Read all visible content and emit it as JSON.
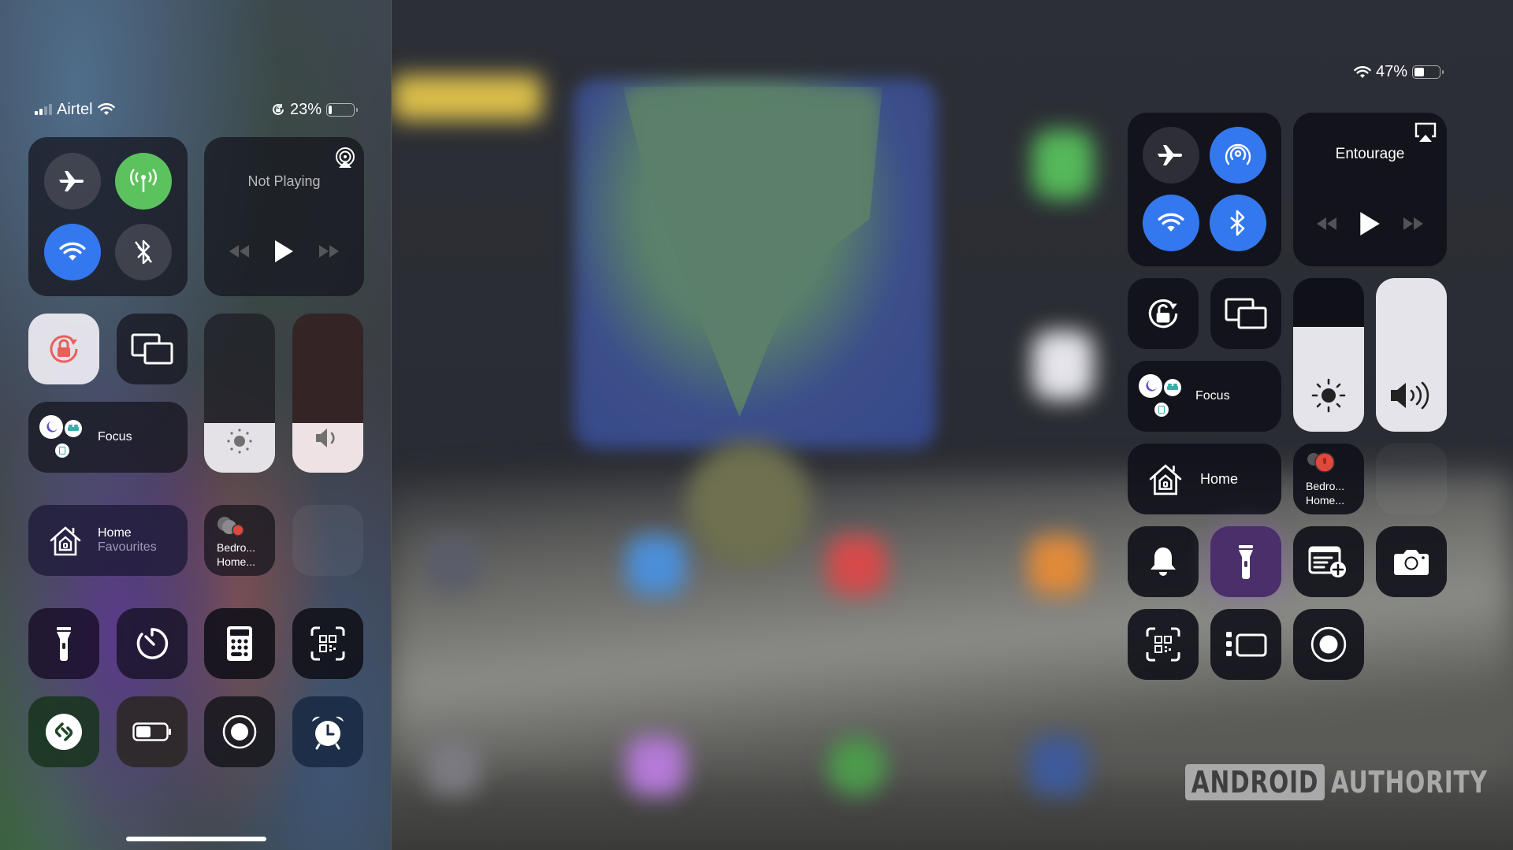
{
  "colors": {
    "green_active": "#5cc25e",
    "blue_active": "#3478f0",
    "rotation_lock_red": "#e8605a",
    "torch_active_purple": "#4a2f6b"
  },
  "iphone": {
    "status_bar": {
      "carrier": "Airtel",
      "signal_bars_active": 2,
      "signal_bars_total": 4,
      "wifi_icon": "wifi-icon",
      "rotation_lock_icon": "rotation-lock-icon",
      "battery_percent_label": "23%",
      "battery_level": 0.23
    },
    "connectivity": [
      {
        "name": "airplane-mode",
        "icon": "airplane-icon",
        "active": false
      },
      {
        "name": "cellular-data",
        "icon": "antenna-icon",
        "active": true
      },
      {
        "name": "wifi",
        "icon": "wifi-icon",
        "active": true
      },
      {
        "name": "bluetooth",
        "icon": "bluetooth-off-icon",
        "active": false
      }
    ],
    "media": {
      "title": "Not Playing",
      "airplay_icon": "airplay-audio-icon"
    },
    "rotation_lock": {
      "active": true
    },
    "screen_mirroring": {
      "icon": "screen-mirroring-icon"
    },
    "focus": {
      "label": "Focus"
    },
    "brightness_level": 0.31,
    "volume_level": 0.31,
    "home": {
      "title": "Home",
      "subtitle": "Favourites"
    },
    "home_accessory": {
      "line1": "Bedro...",
      "line2": "Home..."
    },
    "controls_row1": [
      "flashlight-icon",
      "timer-icon",
      "calculator-icon",
      "qr-scanner-icon"
    ],
    "controls_row2": [
      "shazam-icon",
      "low-power-mode-icon",
      "screen-record-icon",
      "alarm-icon"
    ]
  },
  "ipad": {
    "status_bar": {
      "wifi_icon": "wifi-icon",
      "battery_percent_label": "47%",
      "battery_level": 0.47
    },
    "connectivity": [
      {
        "name": "airplane-mode",
        "icon": "airplane-icon",
        "active": false
      },
      {
        "name": "airdrop",
        "icon": "airdrop-icon",
        "active": true
      },
      {
        "name": "wifi",
        "icon": "wifi-icon",
        "active": true
      },
      {
        "name": "bluetooth",
        "icon": "bluetooth-icon",
        "active": true
      }
    ],
    "media": {
      "title": "Entourage",
      "airplay_icon": "airplay-video-icon"
    },
    "focus": {
      "label": "Focus"
    },
    "brightness_level": 0.68,
    "volume_level": 1.0,
    "home": {
      "title": "Home"
    },
    "home_accessory": {
      "line1": "Bedro...",
      "line2": "Home..."
    },
    "controls_row1": [
      "silent-mode-icon",
      "flashlight-icon",
      "quick-note-icon",
      "camera-icon"
    ],
    "controls_row2": [
      "qr-scanner-icon",
      "stage-manager-icon",
      "screen-record-icon"
    ]
  },
  "watermark": {
    "boxed": "ANDROID",
    "text": "AUTHORITY"
  }
}
